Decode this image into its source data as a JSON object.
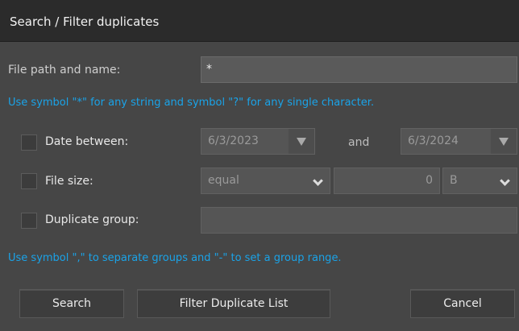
{
  "window": {
    "title": "Search / Filter duplicates"
  },
  "file_path": {
    "label": "File path and name:",
    "value": "*",
    "hint": "Use symbol \"*\" for any string and symbol \"?\" for any single character."
  },
  "date_between": {
    "label": "Date between:",
    "checked": false,
    "from_value": "6/3/2023",
    "and_label": "and",
    "to_value": "6/3/2024",
    "dropdown_icon": "triangle-down-icon"
  },
  "file_size": {
    "label": "File size:",
    "checked": false,
    "comparison_value": "equal",
    "size_value": "0",
    "unit_value": "B",
    "dropdown_icon": "chevron-down-icon"
  },
  "duplicate_group": {
    "label": "Duplicate group:",
    "checked": false,
    "value": "",
    "hint": "Use symbol \",\" to separate groups and \"-\" to set a group range."
  },
  "buttons": {
    "search": "Search",
    "filter": "Filter Duplicate List",
    "cancel": "Cancel"
  },
  "colors": {
    "hint": "#1aa3e8",
    "background": "#464646",
    "titlebar": "#2b2b2b"
  }
}
